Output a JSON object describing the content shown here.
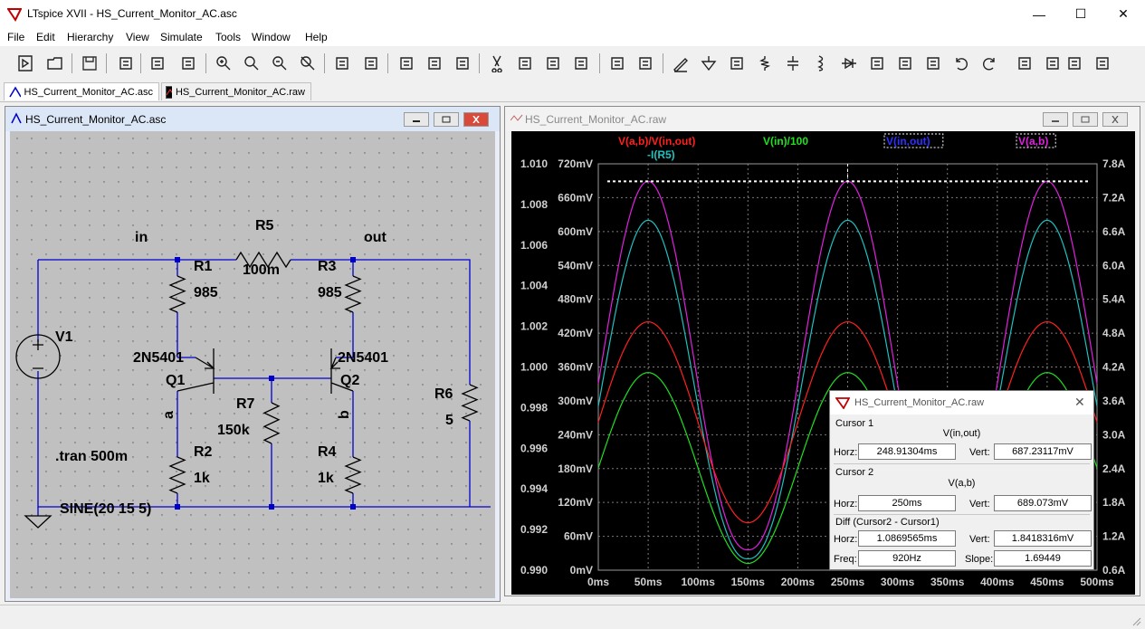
{
  "window": {
    "title": "LTspice XVII - HS_Current_Monitor_AC.asc",
    "minimize": "—",
    "maximize": "☐",
    "close": "✕"
  },
  "menu": [
    "File",
    "Edit",
    "Hierarchy",
    "View",
    "Simulate",
    "Tools",
    "Window",
    "Help"
  ],
  "toolbar_icons": [
    "open-new-schematic-icon",
    "open-folder-icon",
    "save-icon",
    "control-panel-icon",
    "run-icon",
    "halt-icon",
    "zoom-in-icon",
    "zoom-pan-icon",
    "zoom-out-icon",
    "zoom-cancel-icon",
    "autorange-icon",
    "grid-icon",
    "tile-horizontal-icon",
    "cascade-icon",
    "tile-vertical-icon",
    "cut-icon",
    "copy-icon",
    "paste-icon",
    "find-icon",
    "print-setup-icon",
    "print-icon",
    "draw-wire-icon",
    "ground-icon",
    "label-net-icon",
    "resistor-icon",
    "capacitor-icon",
    "inductor-icon",
    "diode-icon",
    "component-icon",
    "move-icon",
    "drag-icon",
    "undo-icon",
    "redo-icon",
    "rotate-icon",
    "mirror-icon",
    "text-icon",
    "spice-directive-icon"
  ],
  "tabs": [
    {
      "label": "HS_Current_Monitor_AC.asc",
      "icon": "schematic-icon"
    },
    {
      "label": "HS_Current_Monitor_AC.raw",
      "icon": "waveform-icon"
    }
  ],
  "schematic": {
    "title": "HS_Current_Monitor_AC.asc",
    "bg": "#c0c0c0",
    "wire_color": "#0000cd",
    "labels": {
      "in": "in",
      "out": "out",
      "R5": "R5",
      "R5v": "100m",
      "R1": "R1",
      "R1v": "985",
      "R3": "R3",
      "R3v": "985",
      "V1": "V1",
      "Q1t": "2N5401",
      "Q1": "Q1",
      "Q2t": "2N5401",
      "Q2": "Q2",
      "R7": "R7",
      "R7v": "150k",
      "R6": "R6",
      "R6v": "5",
      "a": "a",
      "b": "b",
      "R2": "R2",
      "R2v": "1k",
      "R4": "R4",
      "R4v": "1k",
      "tran": ".tran 500m",
      "sine": "SINE(20 15 5)"
    }
  },
  "waveform": {
    "title": "HS_Current_Monitor_AC.raw",
    "legend": [
      {
        "label": "V(a,b)/V(in,out)",
        "color": "#ff2020"
      },
      {
        "label": "-I(R5)",
        "color": "#20c0c0"
      },
      {
        "label": "V(in)/100",
        "color": "#20e020"
      },
      {
        "label": "V(in,out)",
        "color": "#3030ff"
      },
      {
        "label": "V(a,b)",
        "color": "#e020e0"
      }
    ]
  },
  "chart_data": {
    "type": "line",
    "x_ticks": [
      "0ms",
      "50ms",
      "100ms",
      "150ms",
      "200ms",
      "250ms",
      "300ms",
      "350ms",
      "400ms",
      "450ms",
      "500ms"
    ],
    "y_left_ticks": [
      "1.010",
      "1.008",
      "1.006",
      "1.004",
      "1.002",
      "1.000",
      "0.998",
      "0.996",
      "0.994",
      "0.992",
      "0.990"
    ],
    "y_mid_ticks": [
      "720mV",
      "660mV",
      "600mV",
      "540mV",
      "480mV",
      "420mV",
      "360mV",
      "300mV",
      "240mV",
      "180mV",
      "120mV",
      "60mV",
      "0mV"
    ],
    "y_right_ticks": [
      "7.8A",
      "7.2A",
      "6.6A",
      "6.0A",
      "5.4A",
      "4.8A",
      "4.2A",
      "3.6A",
      "3.0A",
      "2.4A",
      "1.8A",
      "1.2A",
      "0.6A"
    ],
    "xlim": [
      0,
      500
    ],
    "ylim_mv": [
      0,
      720
    ],
    "grid": true,
    "series": [
      {
        "name": "V(a,b)",
        "color": "#e020e0",
        "unit": "mV",
        "min": 36,
        "max": 689
      },
      {
        "name": "-I(R5)",
        "color": "#20c0c0",
        "unit": "mV",
        "min": 20,
        "max": 620
      },
      {
        "name": "V(in)/100",
        "color": "#20e020",
        "unit": "mV",
        "min": 12,
        "max": 350
      },
      {
        "name": "V(a,b)/V(in,out)",
        "color": "#ff2020",
        "unit": "mV",
        "min": 84,
        "max": 440
      }
    ],
    "cursor_x_ms": 250,
    "cursor_y_mv": 689
  },
  "cursor_dialog": {
    "title": "HS_Current_Monitor_AC.raw",
    "c1_label": "Cursor 1",
    "c1_trace": "V(in,out)",
    "c1_horz_label": "Horz:",
    "c1_horz": "248.91304ms",
    "c1_vert_label": "Vert:",
    "c1_vert": "687.23117mV",
    "c2_label": "Cursor 2",
    "c2_trace": "V(a,b)",
    "c2_horz_label": "Horz:",
    "c2_horz": "250ms",
    "c2_vert_label": "Vert:",
    "c2_vert": "689.073mV",
    "diff_label": "Diff (Cursor2 - Cursor1)",
    "d_horz_label": "Horz:",
    "d_horz": "1.0869565ms",
    "d_vert_label": "Vert:",
    "d_vert": "1.8418316mV",
    "freq_label": "Freq:",
    "freq": "920Hz",
    "slope_label": "Slope:",
    "slope": "1.69449"
  }
}
